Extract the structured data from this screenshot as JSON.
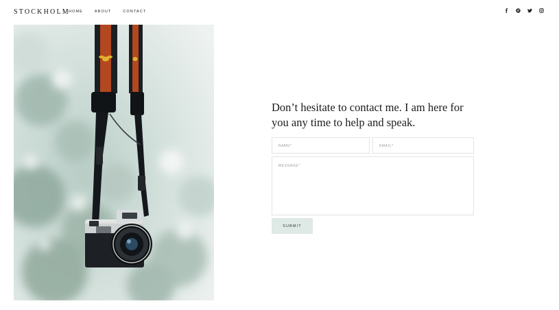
{
  "header": {
    "logo": "STOCKHOLM",
    "nav": [
      {
        "label": "HOME"
      },
      {
        "label": "ABOUT"
      },
      {
        "label": "CONTACT"
      }
    ],
    "social": [
      "facebook-icon",
      "pinterest-icon",
      "twitter-icon",
      "instagram-icon"
    ]
  },
  "contact": {
    "heading": "Don’t hesitate to contact me. I am here for you any time to help and speak.",
    "fields": {
      "name_placeholder": "NAME*",
      "email_placeholder": "EMAIL*",
      "message_placeholder": "MESSAGE*"
    },
    "submit_label": "SUBMIT"
  },
  "colors": {
    "submit_bg": "#dfe9e6",
    "photo_bg": "#dfe7e4"
  }
}
